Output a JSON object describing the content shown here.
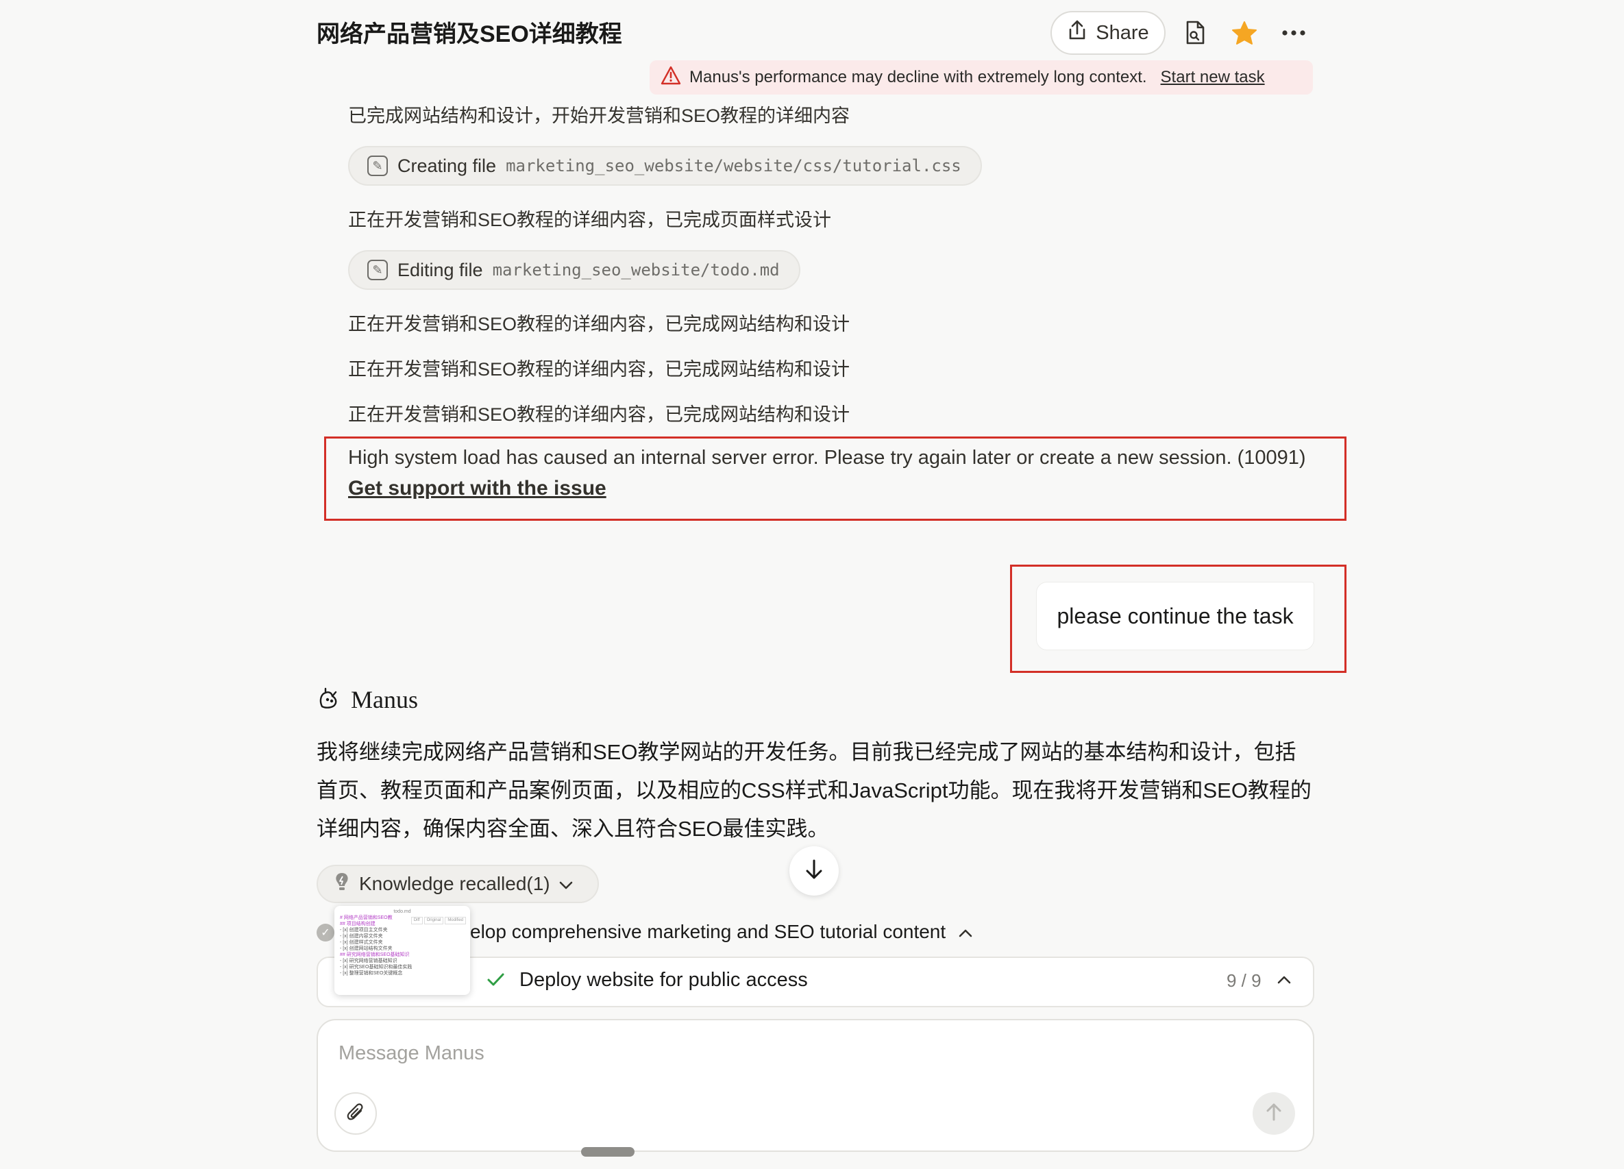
{
  "header": {
    "title": "网络产品营销及SEO详细教程",
    "share_label": "Share",
    "icons": [
      "share-icon",
      "file-icon",
      "star-icon",
      "more-icon"
    ],
    "star_color": "#f5a623"
  },
  "warning": {
    "text": "Manus's performance may decline with extremely long context.",
    "link": "Start new task"
  },
  "steps": [
    "已完成网站结构和设计，开始开发营销和SEO教程的详细内容",
    "正在开发营销和SEO教程的详细内容，已完成页面样式设计",
    "正在开发营销和SEO教程的详细内容，已完成网站结构和设计",
    "正在开发营销和SEO教程的详细内容，已完成网站结构和设计",
    "正在开发营销和SEO教程的详细内容，已完成网站结构和设计"
  ],
  "file_actions": [
    {
      "verb": "Creating file",
      "path": "marketing_seo_website/website/css/tutorial.css"
    },
    {
      "verb": "Editing file",
      "path": "marketing_seo_website/todo.md"
    }
  ],
  "error": {
    "text": "High system load has caused an internal server error. Please try again later or create a new session. (10091)",
    "link": "Get support with the issue"
  },
  "user_message": "please continue the task",
  "assistant": {
    "name": "Manus",
    "paragraph": "我将继续完成网络产品营销和SEO教学网站的开发任务。目前我已经完成了网站的基本结构和设计，包括首页、教程页面和产品案例页面，以及相应的CSS样式和JavaScript功能。现在我将开发营销和SEO教程的详细内容，确保内容全面、深入且符合SEO最佳实践。",
    "knowledge_label": "Knowledge recalled(1)"
  },
  "thumbnail": {
    "title": "todo.md",
    "tabs": [
      "Diff",
      "Original",
      "Modified"
    ],
    "lines": [
      "# 网络产品营销和SEO教",
      "## 项目结构创建",
      "- [x] 创建项目主文件夹",
      "- [x] 创建内容文件夹",
      "- [x] 创建样式文件夹",
      "- [x] 创建网站结构文件夹",
      "## 研究网络营销和SEO基础知识",
      "- [x] 研究网络营销基础知识",
      "- [x] 研究SEO基础知识和最佳实践",
      "- [x] 整理营销和SEO关键概念"
    ]
  },
  "task": {
    "current": "velop comprehensive marketing and SEO tutorial content",
    "deploy_label": "Deploy website for public access",
    "progress": "9 / 9"
  },
  "composer": {
    "placeholder": "Message Manus"
  }
}
